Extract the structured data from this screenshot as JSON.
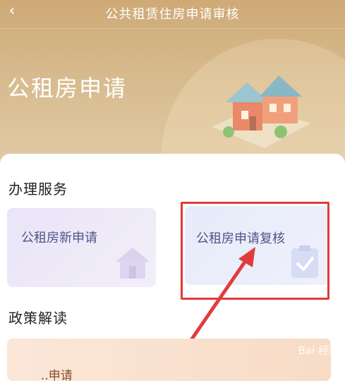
{
  "topbar": {
    "back_icon": "chevron-left-icon",
    "title": "公共租赁住房申请审核"
  },
  "hero": {
    "title": "公租房申请",
    "illustration": "house-illustration"
  },
  "services": {
    "section_title": "办理服务",
    "tiles": [
      {
        "label": "公租房新申请",
        "icon": "house-icon"
      },
      {
        "label": "公租房申请复核",
        "icon": "clipboard-check-icon"
      }
    ]
  },
  "policy": {
    "section_title": "政策解读",
    "item_label": "..申请"
  },
  "annotation": {
    "highlight_color": "#e23b3b",
    "arrow_color": "#e23b3b"
  },
  "watermark": {
    "text": "Bai 经验"
  },
  "colors": {
    "header_gold": "#cfa976",
    "tile_text": "#4f5488"
  }
}
